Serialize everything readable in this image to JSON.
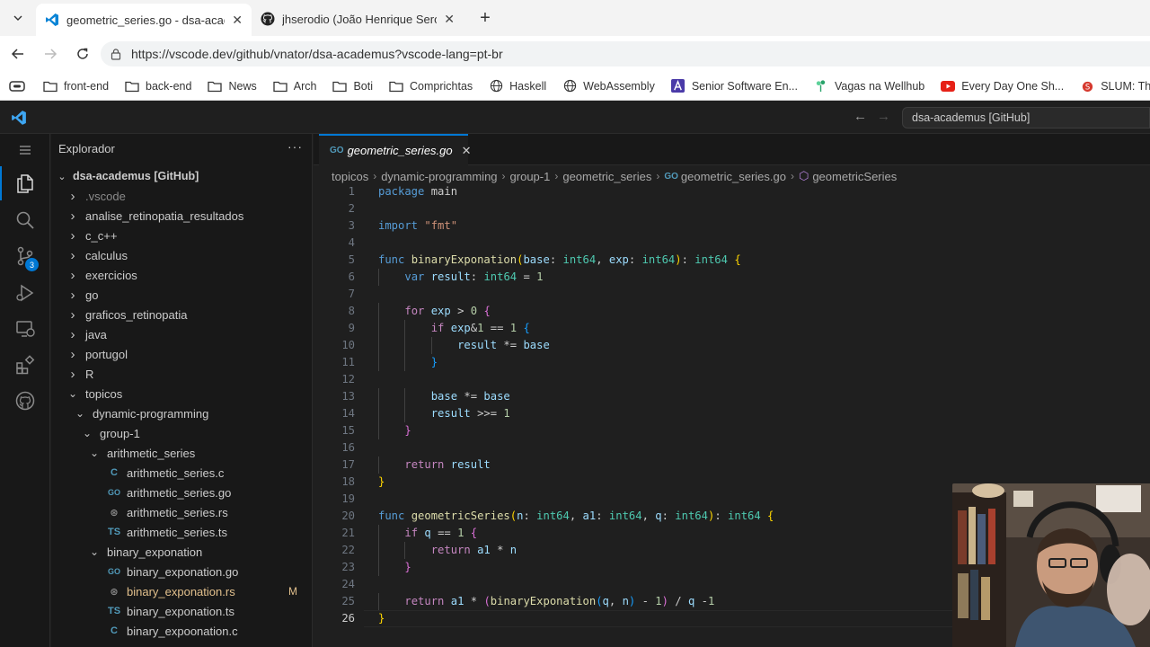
{
  "browser": {
    "tabs": [
      {
        "title": "geometric_series.go - dsa-academus",
        "icon": "vscode-icon",
        "active": true
      },
      {
        "title": "jhserodio (João Henrique Serodio)",
        "icon": "github-icon",
        "active": false
      }
    ],
    "url": "https://vscode.dev/github/vnator/dsa-academus?vscode-lang=pt-br",
    "bookmarks": [
      {
        "label": "front-end",
        "icon": "folder-icon"
      },
      {
        "label": "back-end",
        "icon": "folder-icon"
      },
      {
        "label": "News",
        "icon": "folder-icon"
      },
      {
        "label": "Arch",
        "icon": "folder-icon"
      },
      {
        "label": "Boti",
        "icon": "folder-icon"
      },
      {
        "label": "Comprichtas",
        "icon": "folder-icon"
      },
      {
        "label": "Haskell",
        "icon": "globe-icon"
      },
      {
        "label": "WebAssembly",
        "icon": "globe-icon"
      },
      {
        "label": "Senior Software En...",
        "icon": "a-logo-icon"
      },
      {
        "label": "Vagas na Wellhub",
        "icon": "sprout-icon"
      },
      {
        "label": "Every Day One Sh...",
        "icon": "youtube-icon"
      },
      {
        "label": "SLUM: The Sh",
        "icon": "slum-icon"
      }
    ]
  },
  "vscode": {
    "command_center": "dsa-academus [GitHub]",
    "activity_badge": "3",
    "explorer": {
      "title": "Explorador",
      "root": "dsa-academus [GitHub]",
      "items": [
        {
          "label": ".vscode",
          "kind": "folder",
          "depth": 1,
          "open": false,
          "dim": true
        },
        {
          "label": "analise_retinopatia_resultados",
          "kind": "folder",
          "depth": 1,
          "open": false
        },
        {
          "label": "c_c++",
          "kind": "folder",
          "depth": 1,
          "open": false
        },
        {
          "label": "calculus",
          "kind": "folder",
          "depth": 1,
          "open": false
        },
        {
          "label": "exercicios",
          "kind": "folder",
          "depth": 1,
          "open": false
        },
        {
          "label": "go",
          "kind": "folder",
          "depth": 1,
          "open": false
        },
        {
          "label": "graficos_retinopatia",
          "kind": "folder",
          "depth": 1,
          "open": false
        },
        {
          "label": "java",
          "kind": "folder",
          "depth": 1,
          "open": false
        },
        {
          "label": "portugol",
          "kind": "folder",
          "depth": 1,
          "open": false
        },
        {
          "label": "R",
          "kind": "folder",
          "depth": 1,
          "open": false
        },
        {
          "label": "topicos",
          "kind": "folder",
          "depth": 1,
          "open": true
        },
        {
          "label": "dynamic-programming",
          "kind": "folder",
          "depth": 2,
          "open": true
        },
        {
          "label": "group-1",
          "kind": "folder",
          "depth": 3,
          "open": true
        },
        {
          "label": "arithmetic_series",
          "kind": "folder",
          "depth": 4,
          "open": true
        },
        {
          "label": "arithmetic_series.c",
          "kind": "c",
          "depth": 5
        },
        {
          "label": "arithmetic_series.go",
          "kind": "go",
          "depth": 5
        },
        {
          "label": "arithmetic_series.rs",
          "kind": "rs",
          "depth": 5
        },
        {
          "label": "arithmetic_series.ts",
          "kind": "ts",
          "depth": 5
        },
        {
          "label": "binary_exponation",
          "kind": "folder",
          "depth": 4,
          "open": true
        },
        {
          "label": "binary_exponation.go",
          "kind": "go",
          "depth": 5
        },
        {
          "label": "binary_exponation.rs",
          "kind": "rs",
          "depth": 5,
          "modified": "M"
        },
        {
          "label": "binary_exponation.ts",
          "kind": "ts",
          "depth": 5
        },
        {
          "label": "binary_expoonation.c",
          "kind": "c",
          "depth": 5
        }
      ]
    },
    "editor": {
      "tab_label": "geometric_series.go",
      "breadcrumbs": [
        "topicos",
        "dynamic-programming",
        "group-1",
        "geometric_series",
        "geometric_series.go",
        "geometricSeries"
      ],
      "current_line": 26,
      "lines": [
        "package main",
        "",
        "import \"fmt\"",
        "",
        "func binaryExponation(base: int64, exp: int64): int64 {",
        "    var result: int64 = 1",
        "",
        "    for exp > 0 {",
        "        if exp&1 == 1 {",
        "            result *= base",
        "        }",
        "",
        "        base *= base",
        "        result >>= 1",
        "    }",
        "",
        "    return result",
        "}",
        "",
        "func geometricSeries(n: int64, a1: int64, q: int64): int64 {",
        "    if q == 1 {",
        "        return a1 * n",
        "    }",
        "",
        "    return a1 * (binaryExponation(q, n) - 1) / q -1",
        "}"
      ]
    }
  },
  "colors": {
    "accent": "#0078d4",
    "keyword": "#569cd6",
    "control": "#c586c0",
    "function": "#dcdcaa",
    "type": "#4ec9b0",
    "variable": "#9cdcfe",
    "number": "#b5cea8",
    "string": "#ce9178"
  }
}
